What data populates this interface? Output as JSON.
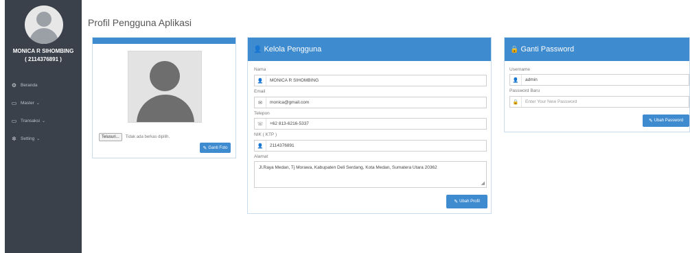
{
  "user": {
    "name": "MONICA R SIHOMBING",
    "nik_display": "( 2114376891 )"
  },
  "nav": [
    {
      "label": "Beranda",
      "icon": "dashboard-icon",
      "caret": ""
    },
    {
      "label": "Master",
      "icon": "monitor-icon",
      "caret": "⌄"
    },
    {
      "label": "Transaksi",
      "icon": "monitor-icon",
      "caret": "⌄"
    },
    {
      "label": "Setting",
      "icon": "gear-icon",
      "caret": "⌄"
    }
  ],
  "page_title": "Profil Pengguna Aplikasi",
  "photo_panel": {
    "file_button": "Telusuri...",
    "file_status": "Tidak ada berkas dipilih.",
    "change_photo_button": "Ganti Foto"
  },
  "manage_panel": {
    "title": "Kelola Pengguna",
    "fields": {
      "nama": {
        "label": "Nama",
        "value": "MONICA R SIHOMBING"
      },
      "email": {
        "label": "Email",
        "value": "monica@gmail.com"
      },
      "telepon": {
        "label": "Telepon",
        "value": "+62 813-6216-5337"
      },
      "nik": {
        "label": "NIK ( KTP )",
        "value": "2114376891"
      },
      "alamat": {
        "label": "Alamat",
        "value": "Jl.Raya Medan, Tj Morawa, Kabupaten Deli Serdang, Kota Medan, Sumatera Utara 20362"
      }
    },
    "submit_button": "Ubah Profil"
  },
  "password_panel": {
    "title": "Ganti Password",
    "username": {
      "label": "Username",
      "value": "admin"
    },
    "new_password": {
      "label": "Password Baru",
      "placeholder": "Enter Your New Password"
    },
    "submit_button": "Ubah Password"
  },
  "colors": {
    "sidebar": "#3a414b",
    "accent": "#3f8bd0"
  }
}
